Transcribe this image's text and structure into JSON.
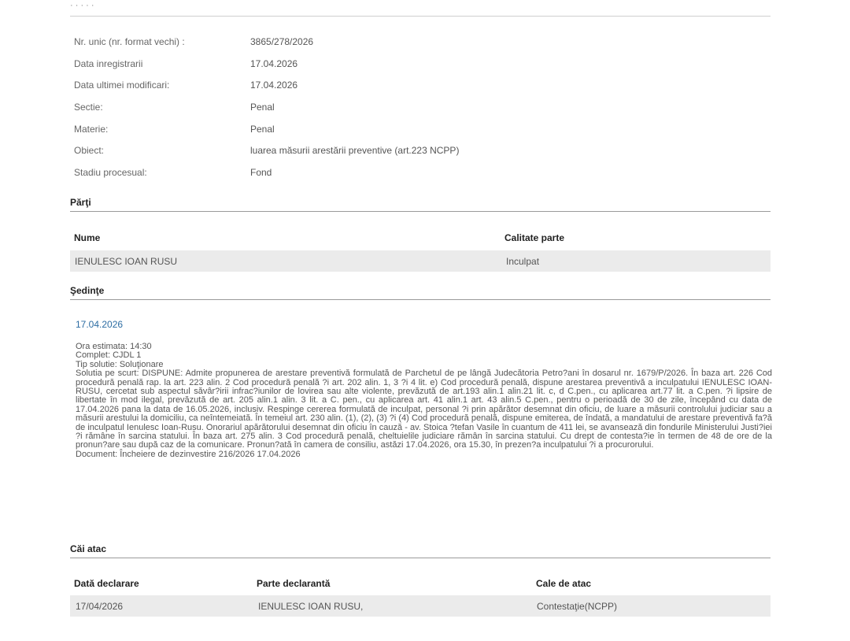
{
  "info": [
    {
      "label": "Nr. unic (nr. format vechi) :",
      "value": "3865/278/2026"
    },
    {
      "label": "Data inregistrarii",
      "value": "17.04.2026"
    },
    {
      "label": "Data ultimei modificari:",
      "value": "17.04.2026"
    },
    {
      "label": "Sectie:",
      "value": "Penal"
    },
    {
      "label": "Materie:",
      "value": "Penal"
    },
    {
      "label": "Obiect:",
      "value": "luarea măsurii arestării preventive (art.223 NCPP)"
    },
    {
      "label": "Stadiu procesual:",
      "value": "Fond"
    }
  ],
  "parti": {
    "title": "Părţi",
    "headers": {
      "nume": "Nume",
      "calitate": "Calitate parte"
    },
    "rows": [
      {
        "nume": "IENULESC IOAN RUSU",
        "calitate": "Inculpat"
      }
    ]
  },
  "sedinte": {
    "title": "Şedinţe",
    "date": "17.04.2026",
    "ora": "Ora estimata: 14:30",
    "complet": "Complet: CJDL 1",
    "tip": "Tip solutie: Soluţionare",
    "solutie": "Solutia pe scurt: DISPUNE: Admite propunerea de arestare preventivă formulată de Parchetul de pe lângă Judecătoria Petro?ani în dosarul nr. 1679/P/2026. În baza art. 226 Cod procedură penală rap. la art. 223 alin. 2 Cod procedură penală ?i art. 202 alin. 1, 3 ?i 4 lit. e) Cod procedură penală, dispune arestarea preventivă a inculpatului IENULESC IOAN-RUSU, cercetat sub aspectul săvâr?irii infrac?iunilor de lovirea sau alte violente, prevăzută de art.193 alin.1 alin.21 lit. c, d C.pen., cu aplicarea art.77 lit. a C.pen. ?i lipsire de libertate în mod ilegal, prevăzută de art. 205 alin.1 alin. 3 lit. a C. pen., cu aplicarea art. 41 alin.1 art. 43 alin.5 C.pen., pentru o perioadă de 30 de zile, începând cu data de 17.04.2026 pana la data de 16.05.2026, inclusiv. Respinge cererea formulată de inculpat, personal ?i prin apărător desemnat din oficiu, de luare a măsurii controlului judiciar sau a măsurii arestului la domiciliu, ca neîntemeiată. În temeiul art. 230 alin. (1), (2), (3) ?i (4) Cod procedură penală, dispune emiterea, de îndată, a mandatului de arestare preventivă fa?ă de inculpatul Ienulesc Ioan-Rusu. Onorariul apărătorului desemnat din oficiu în cauză - av. Stoica ?tefan Vasile în cuantum de 411 lei, se avansează din fondurile Ministerului Justi?iei ?i rămâne în sarcina statului. În baza art. 275 alin. 3 Cod procedură penală, cheltuielile judiciare rămân în sarcina statului. Cu drept de contesta?ie în termen de 48 de ore de la pronun?are sau după caz de la comunicare. Pronun?ată în camera de consiliu, astăzi 17.04.2026, ora 15.30, în prezen?a inculpatului ?i a procurorului.",
    "document": "Document: Încheiere de dezinvestire  216/2026  17.04.2026"
  },
  "cai_atac": {
    "title": "Căi atac",
    "headers": {
      "data": "Dată declarare",
      "parte": "Parte declarantă",
      "cale": "Cale de atac"
    },
    "rows": [
      {
        "data": "17/04/2026",
        "parte": "IENULESC IOAN RUSU,",
        "cale": "Contestaţie(NCPP)"
      }
    ]
  }
}
